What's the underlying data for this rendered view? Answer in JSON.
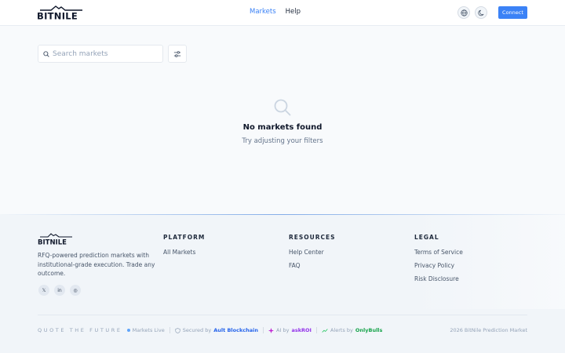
{
  "header": {
    "logo_text": "BITNILE",
    "nav": [
      {
        "label": "Markets",
        "active": true
      },
      {
        "label": "Help",
        "active": false
      }
    ],
    "connect_label": "Connect",
    "icons": [
      "globe-icon",
      "moon-icon"
    ]
  },
  "search": {
    "placeholder": "Search markets",
    "value": ""
  },
  "empty_state": {
    "title": "No markets found",
    "subtitle": "Try adjusting your filters"
  },
  "footer": {
    "logo_text": "BITNILE",
    "description": "RFQ-powered prediction markets with institutional-grade execution. Trade any outcome.",
    "social": [
      {
        "name": "x",
        "glyph": "𝕏"
      },
      {
        "name": "linkedin",
        "glyph": "in"
      },
      {
        "name": "instagram",
        "glyph": "◎"
      }
    ],
    "columns": [
      {
        "heading": "PLATFORM",
        "links": [
          "All Markets"
        ]
      },
      {
        "heading": "RESOURCES",
        "links": [
          "Help Center",
          "FAQ"
        ]
      },
      {
        "heading": "LEGAL",
        "links": [
          "Terms of Service",
          "Privacy Policy",
          "Risk Disclosure"
        ]
      }
    ],
    "bottom": {
      "tagline": "QUOTE THE FUTURE",
      "status": "Markets Live",
      "secured_prefix": "Secured by",
      "secured_brand": "Ault Blockchain",
      "ai_prefix": "AI by",
      "ai_brand": "askROI",
      "alerts_prefix": "Alerts by",
      "alerts_brand": "OnlyBulls",
      "copyright": "2026 BitNile Prediction Market"
    }
  },
  "colors": {
    "accent": "#3b82f6",
    "ault": "#2563eb",
    "askroi": "#9333ea",
    "onlybulls": "#16a34a"
  }
}
